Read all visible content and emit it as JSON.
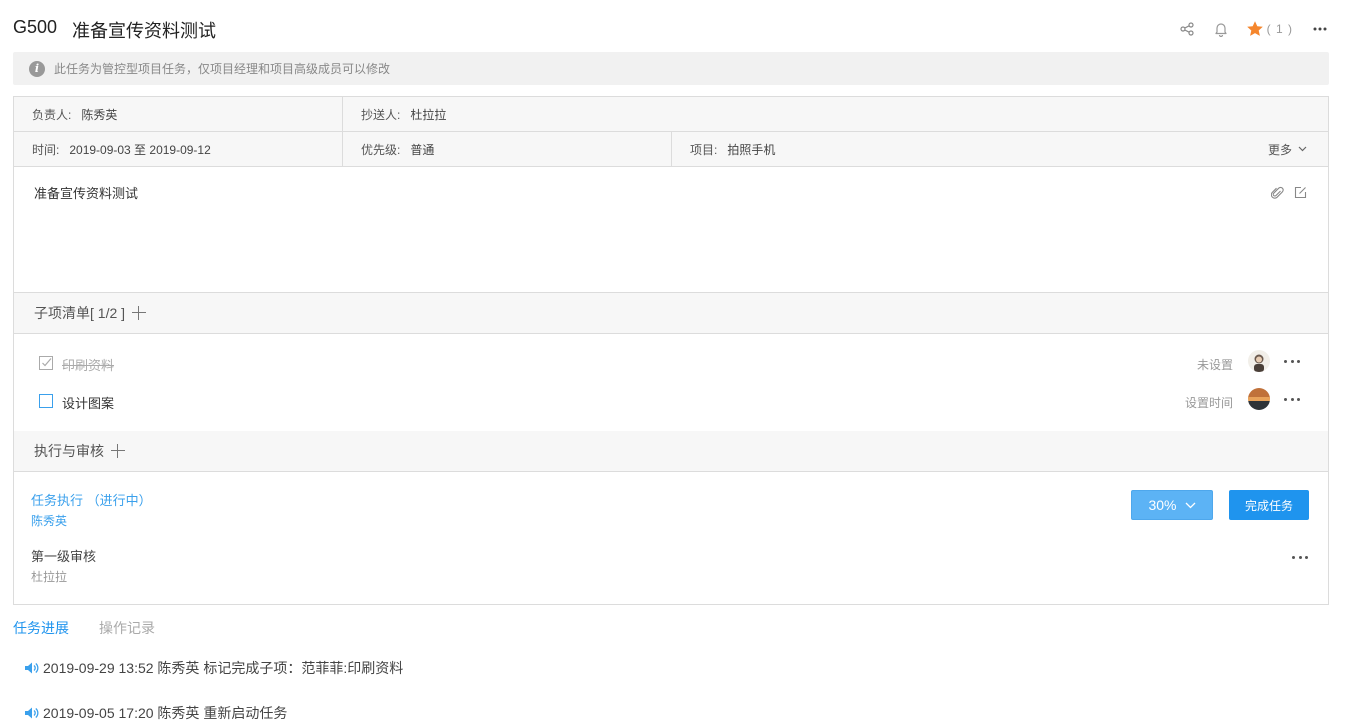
{
  "header": {
    "code": "G500",
    "title": "准备宣传资料测试",
    "star_count": "( 1 )",
    "icons": [
      "share-icon",
      "bell-icon",
      "star-icon",
      "more-icon"
    ]
  },
  "notice": {
    "text": "此任务为管控型项目任务，仅项目经理和项目高级成员可以修改"
  },
  "meta": {
    "owner_label": "负责人:",
    "owner_value": "陈秀英",
    "cc_label": "抄送人:",
    "cc_value": "杜拉拉",
    "time_label": "时间:",
    "time_value": "2019-09-03 至 2019-09-12",
    "priority_label": "优先级:",
    "priority_value": "普通",
    "project_label": "项目:",
    "project_value": "拍照手机",
    "more_label": "更多"
  },
  "description": {
    "text": "准备宣传资料测试"
  },
  "subtasks": {
    "title": "子项清单[ 1/2 ]",
    "items": [
      {
        "label": "印刷资料",
        "done": true,
        "time": "未设置"
      },
      {
        "label": "设计图案",
        "done": false,
        "time": "设置时间"
      }
    ]
  },
  "execution": {
    "title": "执行与审核",
    "exec_title": "任务执行 （进行中）",
    "exec_user": "陈秀英",
    "progress_label": "30%",
    "progress": 0.3,
    "complete_button": "完成任务",
    "review_title": "第一级审核",
    "review_user": "杜拉拉"
  },
  "tabs": [
    {
      "label": "任务进展",
      "active": true
    },
    {
      "label": "操作记录",
      "active": false
    }
  ],
  "logs": [
    {
      "text": "2019-09-29 13:52 陈秀英 标记完成子项：范菲菲:印刷资料"
    },
    {
      "text": "2019-09-05 17:20 陈秀英 重新启动任务"
    }
  ],
  "colors": {
    "accent": "#1f94ee",
    "progress_button": "#5cb3f5",
    "star": "#f5862d"
  }
}
